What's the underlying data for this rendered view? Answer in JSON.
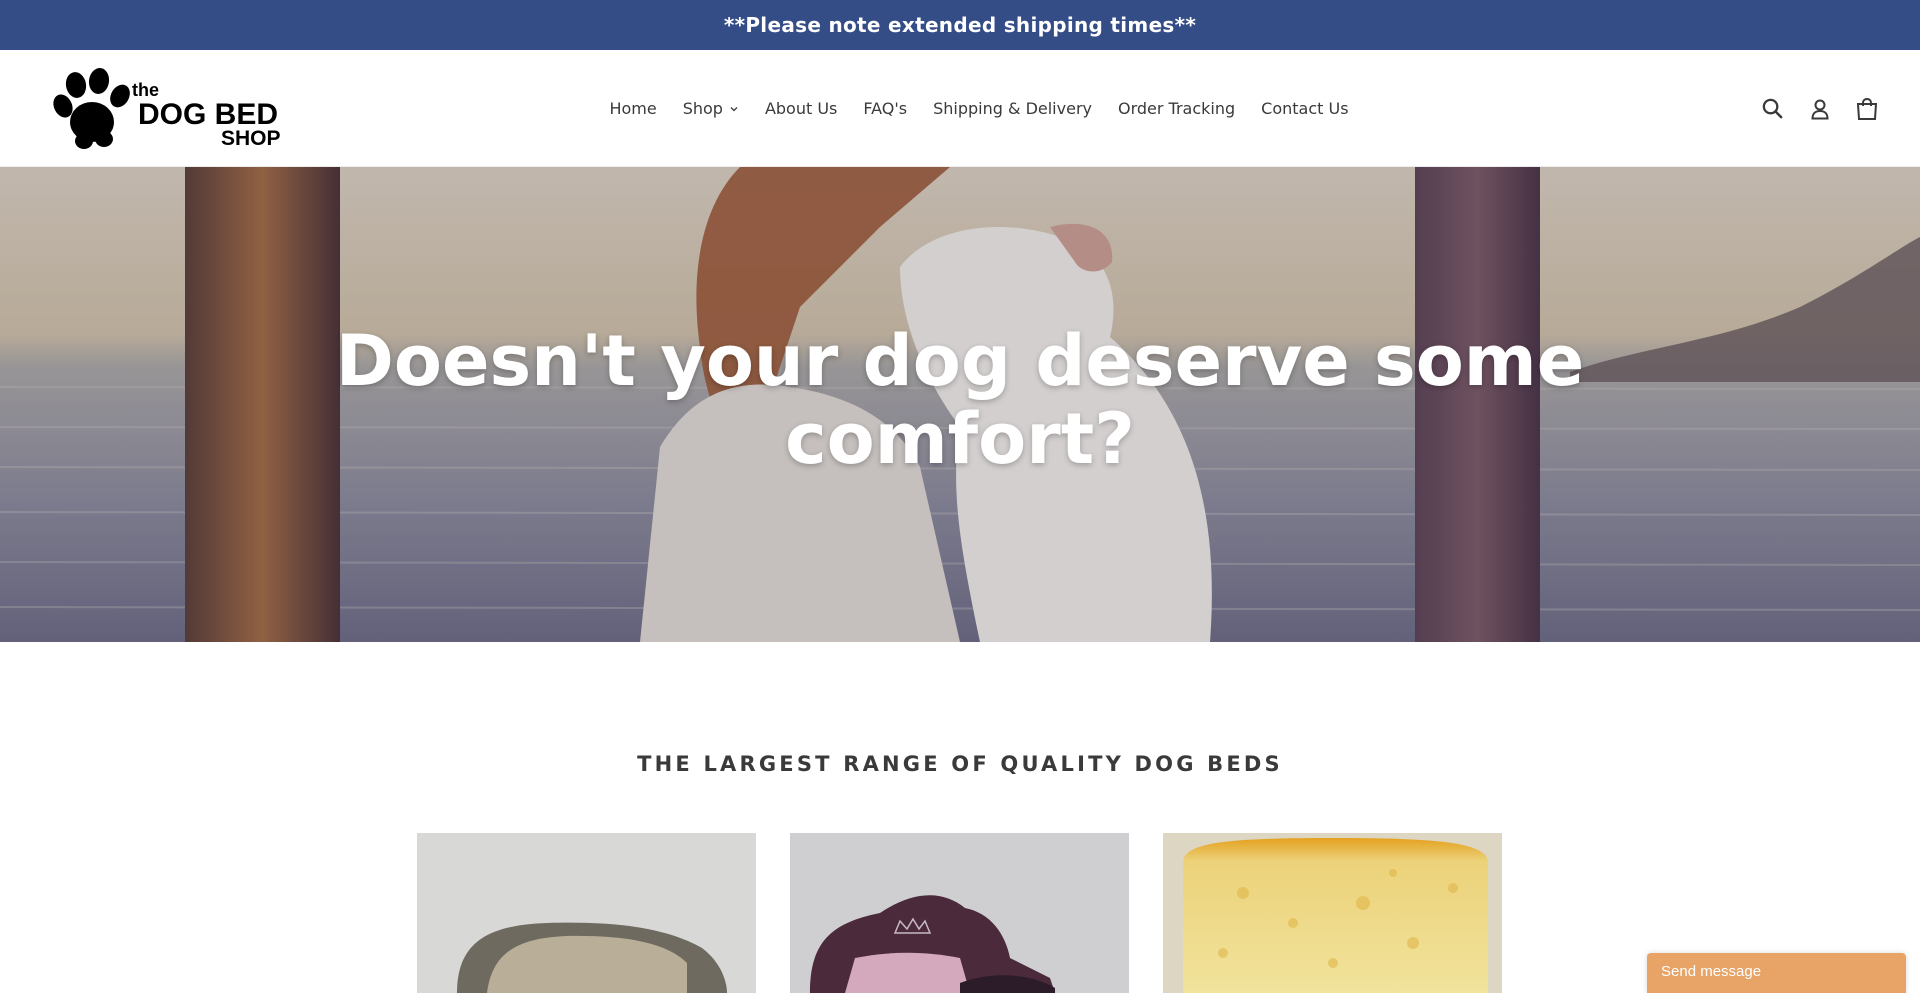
{
  "announcement": {
    "text": "**Please note extended shipping times**"
  },
  "brand": {
    "logo_line1": "the",
    "logo_line2": "DOG BED",
    "logo_line3": "SHOP"
  },
  "nav": {
    "items": [
      {
        "label": "Home"
      },
      {
        "label": "Shop"
      },
      {
        "label": "About Us"
      },
      {
        "label": "FAQ's"
      },
      {
        "label": "Shipping & Delivery"
      },
      {
        "label": "Order Tracking"
      },
      {
        "label": "Contact Us"
      }
    ]
  },
  "header_icons": [
    "search-icon",
    "account-icon",
    "cart-icon"
  ],
  "hero": {
    "title_line1": "Doesn't your dog deserve some",
    "title_line2": "comfort?"
  },
  "section": {
    "title": "THE LARGEST RANGE OF QUALITY DOG BEDS"
  },
  "chat": {
    "label": "Send message"
  },
  "colors": {
    "announcement_bg": "#344d86",
    "chat_bg": "#e8a366",
    "text": "#3a3a3a"
  }
}
